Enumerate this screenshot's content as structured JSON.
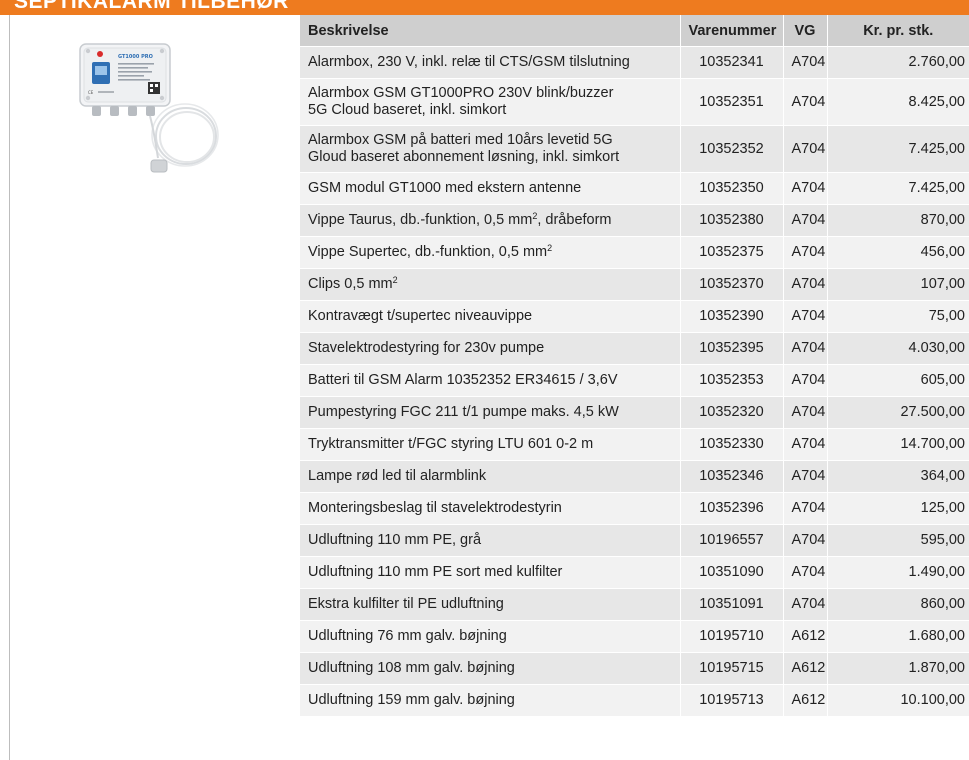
{
  "header": {
    "title": "SEPTIKALARM TILBEHØR",
    "accent_color": "#ee7b1f"
  },
  "image": {
    "device_label": "GT1000 PRO",
    "alt": "Alarmbox med kabel og niveauvippe"
  },
  "table": {
    "columns": [
      "Beskrivelse",
      "Varenummer",
      "VG",
      "Kr. pr. stk."
    ],
    "rows": [
      {
        "desc": "Alarmbox, 230 V, inkl. relæ til CTS/GSM tilslutning",
        "item": "10352341",
        "vg": "A704",
        "price": "2.760,00"
      },
      {
        "desc": "Alarmbox GSM GT1000PRO 230V blink/buzzer",
        "desc2": "5G Cloud baseret, inkl. simkort",
        "item": "10352351",
        "vg": "A704",
        "price": "8.425,00"
      },
      {
        "desc": "Alarmbox GSM på batteri med 10års levetid 5G",
        "desc2": "Gloud baseret abonnement løsning, inkl. simkort",
        "item": "10352352",
        "vg": "A704",
        "price": "7.425,00"
      },
      {
        "desc": "GSM modul GT1000 med ekstern antenne",
        "item": "10352350",
        "vg": "A704",
        "price": "7.425,00"
      },
      {
        "desc": "Vippe Taurus, db.-funktion, 0,5 mm",
        "sup": "2",
        "desc_tail": ", dråbeform",
        "item": "10352380",
        "vg": "A704",
        "price": "870,00"
      },
      {
        "desc": "Vippe Supertec, db.-funktion, 0,5 mm",
        "sup": "2",
        "item": "10352375",
        "vg": "A704",
        "price": "456,00"
      },
      {
        "desc": "Clips 0,5 mm",
        "sup": "2",
        "item": "10352370",
        "vg": "A704",
        "price": "107,00"
      },
      {
        "desc": "Kontravægt t/supertec niveauvippe",
        "item": "10352390",
        "vg": "A704",
        "price": "75,00"
      },
      {
        "desc": "Stavelektrodestyring for 230v pumpe",
        "item": "10352395",
        "vg": "A704",
        "price": "4.030,00"
      },
      {
        "desc": "Batteri til GSM Alarm 10352352 ER34615 / 3,6V",
        "item": "10352353",
        "vg": "A704",
        "price": "605,00"
      },
      {
        "desc": "Pumpestyring FGC 211 t/1 pumpe maks. 4,5 kW",
        "item": "10352320",
        "vg": "A704",
        "price": "27.500,00"
      },
      {
        "desc": "Tryktransmitter t/FGC styring LTU 601 0-2 m",
        "item": "10352330",
        "vg": "A704",
        "price": "14.700,00"
      },
      {
        "desc": "Lampe rød led til alarmblink",
        "item": "10352346",
        "vg": "A704",
        "price": "364,00"
      },
      {
        "desc": "Monteringsbeslag til stavelektrodestyrin",
        "item": "10352396",
        "vg": "A704",
        "price": "125,00"
      },
      {
        "desc": "Udluftning 110 mm PE, grå",
        "item": "10196557",
        "vg": "A704",
        "price": "595,00"
      },
      {
        "desc": "Udluftning 110 mm PE sort med kulfilter",
        "item": "10351090",
        "vg": "A704",
        "price": "1.490,00"
      },
      {
        "desc": "Ekstra kulfilter til PE udluftning",
        "item": "10351091",
        "vg": "A704",
        "price": "860,00"
      },
      {
        "desc": "Udluftning 76 mm galv. bøjning",
        "item": "10195710",
        "vg": "A612",
        "price": "1.680,00"
      },
      {
        "desc": "Udluftning 108 mm galv. bøjning",
        "item": "10195715",
        "vg": "A612",
        "price": "1.870,00"
      },
      {
        "desc": "Udluftning 159 mm galv. bøjning",
        "item": "10195713",
        "vg": "A612",
        "price": "10.100,00"
      }
    ]
  }
}
